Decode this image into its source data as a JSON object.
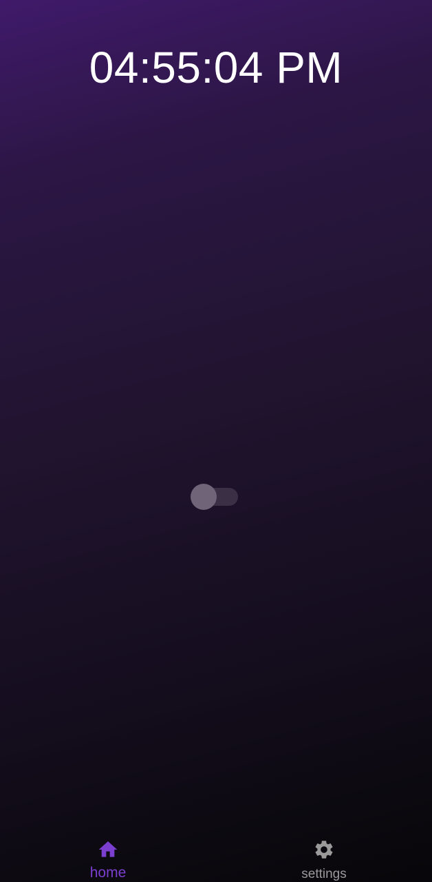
{
  "clock": {
    "time": "04:55:04 PM"
  },
  "toggle": {
    "state": "off"
  },
  "bottom_nav": {
    "items": [
      {
        "label": "home",
        "icon": "home-icon",
        "active": true,
        "color": "#7a3fcf"
      },
      {
        "label": "settings",
        "icon": "gear-icon",
        "active": false,
        "color": "#9a9a9a"
      }
    ]
  },
  "colors": {
    "background_top": "#401a6a",
    "background_bottom": "#080609",
    "accent": "#7a3fcf"
  }
}
